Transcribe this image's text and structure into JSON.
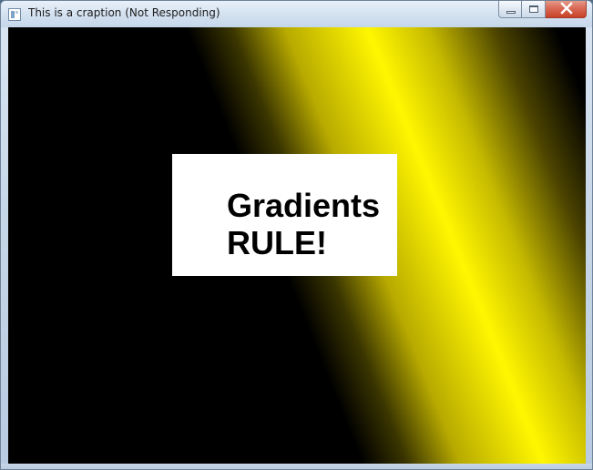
{
  "window": {
    "title": "This is a craption (Not Responding)"
  },
  "canvas": {
    "message_line_1": "Gradients",
    "message_line_2": "RULE!"
  },
  "colors": {
    "gradient_dark": "#000000",
    "gradient_highlight": "#fff700",
    "panel_background": "#ffffff",
    "text": "#000000"
  },
  "icons": {
    "app": "application-icon",
    "minimize": "minimize-icon",
    "maximize": "maximize-icon",
    "close": "close-icon"
  }
}
